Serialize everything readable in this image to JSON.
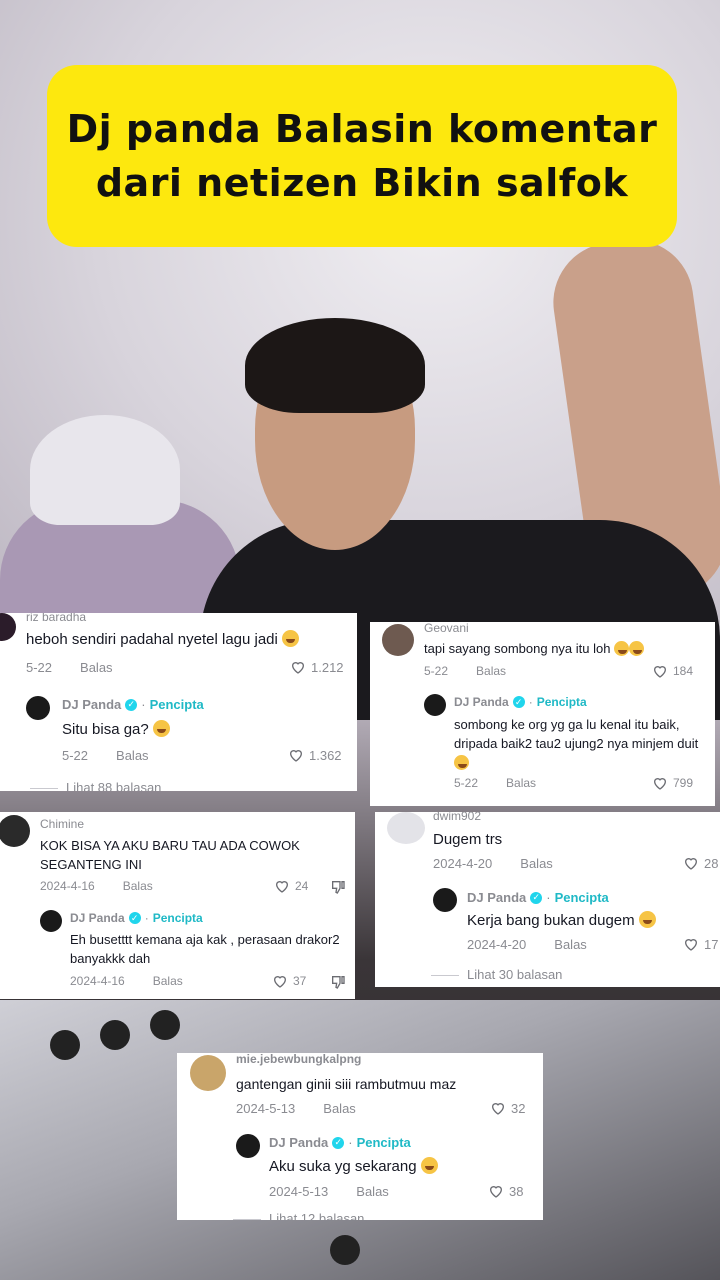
{
  "title": {
    "line1": "Dj panda Balasin komentar",
    "line2": "dari netizen Bikin salfok"
  },
  "cards": [
    {
      "user": "riz baradha",
      "comment": "heboh sendiri padahal nyetel lagu jadi",
      "date": "5-22",
      "reply": "Balas",
      "likes": "1.212",
      "creator": {
        "name": "DJ Panda",
        "dot": "·",
        "tag": "Pencipta",
        "text": "Situ bisa ga?",
        "date": "5-22",
        "reply": "Balas",
        "likes": "1.362"
      },
      "more": "Lihat 88 balasan"
    },
    {
      "user": "Geovani",
      "comment": "tapi sayang sombong nya itu loh",
      "date": "5-22",
      "reply": "Balas",
      "likes": "184",
      "creator": {
        "name": "DJ Panda",
        "dot": "·",
        "tag": "Pencipta",
        "text": "sombong ke org yg ga lu kenal itu baik, dripada baik2 tau2 ujung2 nya minjem duit",
        "date": "5-22",
        "reply": "Balas",
        "likes": "799"
      }
    },
    {
      "user": "Chimine",
      "comment": "KOK BISA YA AKU BARU TAU ADA COWOK SEGANTENG INI",
      "date": "2024-4-16",
      "reply": "Balas",
      "likes": "24",
      "creator": {
        "name": "DJ Panda",
        "dot": "·",
        "tag": "Pencipta",
        "text": "Eh busetttt kemana aja kak , perasaan drakor2 banyakkk dah",
        "date": "2024-4-16",
        "reply": "Balas",
        "likes": "37"
      }
    },
    {
      "user": "dwim902",
      "comment": "Dugem trs",
      "date": "2024-4-20",
      "reply": "Balas",
      "likes": "28",
      "creator": {
        "name": "DJ Panda",
        "dot": "·",
        "tag": "Pencipta",
        "text": "Kerja bang bukan dugem",
        "date": "2024-4-20",
        "reply": "Balas",
        "likes": "17"
      },
      "more": "Lihat 30 balasan"
    },
    {
      "user": "mie.jebewbungkalpng",
      "comment": "gantengan ginii siii rambutmuu maz",
      "date": "2024-5-13",
      "reply": "Balas",
      "likes": "32",
      "creator": {
        "name": "DJ Panda",
        "dot": "·",
        "tag": "Pencipta",
        "text": "Aku suka yg sekarang",
        "date": "2024-5-13",
        "reply": "Balas",
        "likes": "38"
      },
      "more": "Lihat 12 balasan"
    }
  ]
}
